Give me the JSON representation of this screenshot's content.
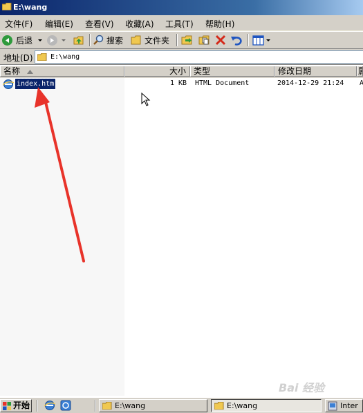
{
  "window": {
    "title": "E:\\wang"
  },
  "menu": [
    {
      "label": "文件(F)"
    },
    {
      "label": "编辑(E)"
    },
    {
      "label": "查看(V)"
    },
    {
      "label": "收藏(A)"
    },
    {
      "label": "工具(T)"
    },
    {
      "label": "帮助(H)"
    }
  ],
  "toolbar": {
    "back": "后退",
    "search": "搜索",
    "folders": "文件夹"
  },
  "address": {
    "label": "地址(D)",
    "value": "E:\\wang"
  },
  "columns": [
    "名称",
    "大小",
    "类型",
    "修改日期",
    "属"
  ],
  "files": [
    {
      "name": "index.htm",
      "size": "1 KB",
      "type": "HTML Document",
      "modified": "2014-12-29 21:24",
      "attr": "A"
    }
  ],
  "taskbar": {
    "start": "开始",
    "task1": "E:\\wang",
    "task2": "E:\\wang",
    "task3": "Inter"
  },
  "watermark": "Bai 经验",
  "colors": {
    "title_start": "#0a246a",
    "title_end": "#a6caf0",
    "arrow": "#e8332a",
    "selection": "#0a246a"
  }
}
